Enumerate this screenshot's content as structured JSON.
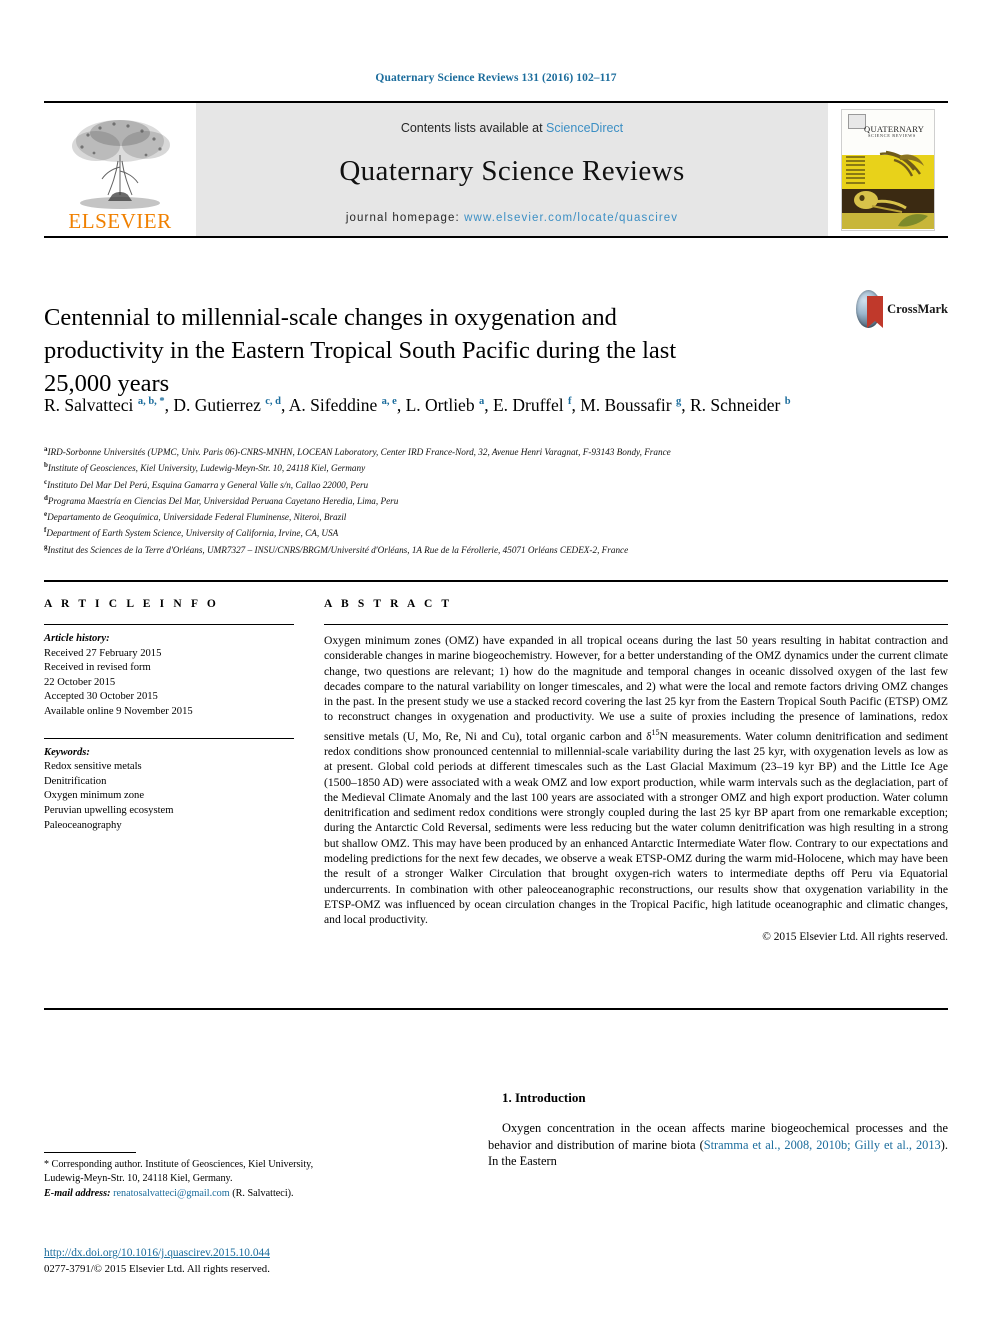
{
  "running_head": "Quaternary Science Reviews 131 (2016) 102–117",
  "masthead": {
    "publisher": "ELSEVIER",
    "contents_prefix": "Contents lists available at ",
    "contents_link": "ScienceDirect",
    "journal_title": "Quaternary Science Reviews",
    "homepage_prefix": "journal homepage: ",
    "homepage_url": "www.elsevier.com/locate/quascirev",
    "cover": {
      "title": "QUATERNARY",
      "subtitle": "SCIENCE REVIEWS",
      "tagline": "THE INTERNATIONAL MULTIDISCIPLINARY RESEARCH AND REVIEW JOURNAL"
    }
  },
  "crossmark": {
    "label": "CrossMark"
  },
  "article": {
    "title": "Centennial to millennial-scale changes in oxygenation and productivity in the Eastern Tropical South Pacific during the last 25,000 years",
    "authors": [
      {
        "name": "R. Salvatteci",
        "marks": "a, b, *"
      },
      {
        "name": "D. Gutierrez",
        "marks": "c, d"
      },
      {
        "name": "A. Sifeddine",
        "marks": "a, e"
      },
      {
        "name": "L. Ortlieb",
        "marks": "a"
      },
      {
        "name": "E. Druffel",
        "marks": "f"
      },
      {
        "name": "M. Boussafir",
        "marks": "g"
      },
      {
        "name": "R. Schneider",
        "marks": "b"
      }
    ],
    "affiliations": [
      {
        "key": "a",
        "text": "IRD-Sorbonne Universités (UPMC, Univ. Paris 06)-CNRS-MNHN, LOCEAN Laboratory, Center IRD France-Nord, 32, Avenue Henri Varagnat, F-93143 Bondy, France"
      },
      {
        "key": "b",
        "text": "Institute of Geosciences, Kiel University, Ludewig-Meyn-Str. 10, 24118 Kiel, Germany"
      },
      {
        "key": "c",
        "text": "Instituto Del Mar Del Perú, Esquina Gamarra y General Valle s/n, Callao 22000, Peru"
      },
      {
        "key": "d",
        "text": "Programa Maestría en Ciencias Del Mar, Universidad Peruana Cayetano Heredia, Lima, Peru"
      },
      {
        "key": "e",
        "text": "Departamento de Geoquímica, Universidade Federal Fluminense, Niteroi, Brazil"
      },
      {
        "key": "f",
        "text": "Department of Earth System Science, University of California, Irvine, CA, USA"
      },
      {
        "key": "g",
        "text": "Institut des Sciences de la Terre d'Orléans, UMR7327 – INSU/CNRS/BRGM/Université d'Orléans, 1A Rue de la Férollerie, 45071 Orléans CEDEX-2, France"
      }
    ]
  },
  "article_info": {
    "heading": "A R T I C L E  I N F O",
    "history_label": "Article history:",
    "history": [
      "Received 27 February 2015",
      "Received in revised form",
      "22 October 2015",
      "Accepted 30 October 2015",
      "Available online 9 November 2015"
    ],
    "keywords_label": "Keywords:",
    "keywords": [
      "Redox sensitive metals",
      "Denitrification",
      "Oxygen minimum zone",
      "Peruvian upwelling ecosystem",
      "Paleoceanography"
    ]
  },
  "abstract": {
    "heading": "A B S T R A C T",
    "part1": "Oxygen minimum zones (OMZ) have expanded in all tropical oceans during the last 50 years resulting in habitat contraction and considerable changes in marine biogeochemistry. However, for a better understanding of the OMZ dynamics under the current climate change, two questions are relevant; 1) how do the magnitude and temporal changes in oceanic dissolved oxygen of the last few decades compare to the natural variability on longer timescales, and 2) what were the local and remote factors driving OMZ changes in the past. In the present study we use a stacked record covering the last 25 kyr from the Eastern Tropical South Pacific (ETSP) OMZ to reconstruct changes in oxygenation and productivity. We use a suite of proxies including the presence of laminations, redox sensitive metals (U, Mo, Re, Ni and Cu), total organic carbon and δ",
    "sup1": "15",
    "part2": "N measurements. Water column denitrification and sediment redox conditions show pronounced centennial to millennial-scale variability during the last 25 kyr, with oxygenation levels as low as at present. Global cold periods at different timescales such as the Last Glacial Maximum (23–19 kyr BP) and the Little Ice Age (1500–1850 AD) were associated with a weak OMZ and low export production, while warm intervals such as the deglaciation, part of the Medieval Climate Anomaly and the last 100 years are associated with a stronger OMZ and high export production. Water column denitrification and sediment redox conditions were strongly coupled during the last 25 kyr BP apart from one remarkable exception; during the Antarctic Cold Reversal, sediments were less reducing but the water column denitrification was high resulting in a strong but shallow OMZ. This may have been produced by an enhanced Antarctic Intermediate Water flow. Contrary to our expectations and modeling predictions for the next few decades, we observe a weak ETSP-OMZ during the warm mid-Holocene, which may have been the result of a stronger Walker Circulation that brought oxygen-rich waters to intermediate depths off Peru via Equatorial undercurrents. In combination with other paleoceanographic reconstructions, our results show that oxygenation variability in the ETSP-OMZ was influenced by ocean circulation changes in the Tropical Pacific, high latitude oceanographic and climatic changes, and local productivity.",
    "copyright": "© 2015 Elsevier Ltd. All rights reserved."
  },
  "introduction": {
    "heading": "1. Introduction",
    "text_before_cite": "Oxygen concentration in the ocean affects marine biogeochemical processes and the behavior and distribution of marine biota (",
    "citation": "Stramma et al., 2008, 2010b; Gilly et al., 2013",
    "text_after_cite": "). In the Eastern"
  },
  "footer": {
    "corresponding_star": "*",
    "corresponding_text": "Corresponding author. Institute of Geosciences, Kiel University, Ludewig-Meyn-Str. 10, 24118 Kiel, Germany.",
    "email_label": "E-mail address:",
    "email": "renatosalvatteci@gmail.com",
    "email_owner": "(R. Salvatteci).",
    "doi": "http://dx.doi.org/10.1016/j.quascirev.2015.10.044",
    "issn_line": "0277-3791/© 2015 Elsevier Ltd. All rights reserved."
  },
  "colors": {
    "link_blue": "#1b6c9c",
    "elsevier_orange": "#f08000",
    "masthead_gray": "#e6e6e6"
  }
}
